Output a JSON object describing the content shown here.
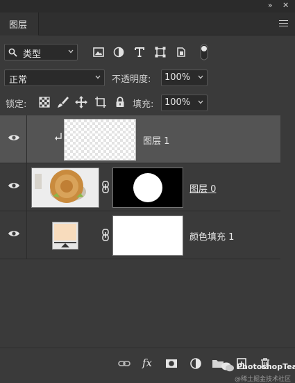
{
  "panel": {
    "tab_label": "图层",
    "collapse_icon": "double-chevron-right-icon",
    "close_icon": "close-icon",
    "menu_icon": "hamburger-menu-icon"
  },
  "filter": {
    "kind_label": "类型",
    "icons": [
      "image-filter-icon",
      "adjustment-filter-icon",
      "type-filter-icon",
      "shape-filter-icon",
      "smart-object-filter-icon",
      "filter-toggle-icon"
    ]
  },
  "blend": {
    "mode": "正常",
    "opacity_label": "不透明度:",
    "opacity_value": "100%"
  },
  "lock": {
    "label": "锁定:",
    "icons": [
      "lock-transparent-pixels-icon",
      "lock-image-pixels-icon",
      "lock-position-icon",
      "lock-artboard-icon",
      "lock-all-icon"
    ],
    "fill_label": "填充:",
    "fill_value": "100%"
  },
  "layers": [
    {
      "name": "图层 1",
      "selected": true,
      "clipped": true,
      "thumb": "transparent"
    },
    {
      "name": "图层 0",
      "selected": false,
      "underline": true,
      "thumb": "mooncake",
      "mask": "circle"
    },
    {
      "name": "颜色填充 1",
      "selected": false,
      "thumb": "color-fill",
      "mask": "white",
      "fill_color": "#f8dcbd"
    }
  ],
  "footer": {
    "icons": [
      "link-layers-icon",
      "layer-style-fx-icon",
      "add-mask-icon",
      "new-adjustment-layer-icon",
      "new-group-icon",
      "new-layer-icon",
      "delete-layer-icon"
    ],
    "watermark_main": "PhotoshopTea",
    "watermark_sub": "@稀土掘金技术社区"
  }
}
